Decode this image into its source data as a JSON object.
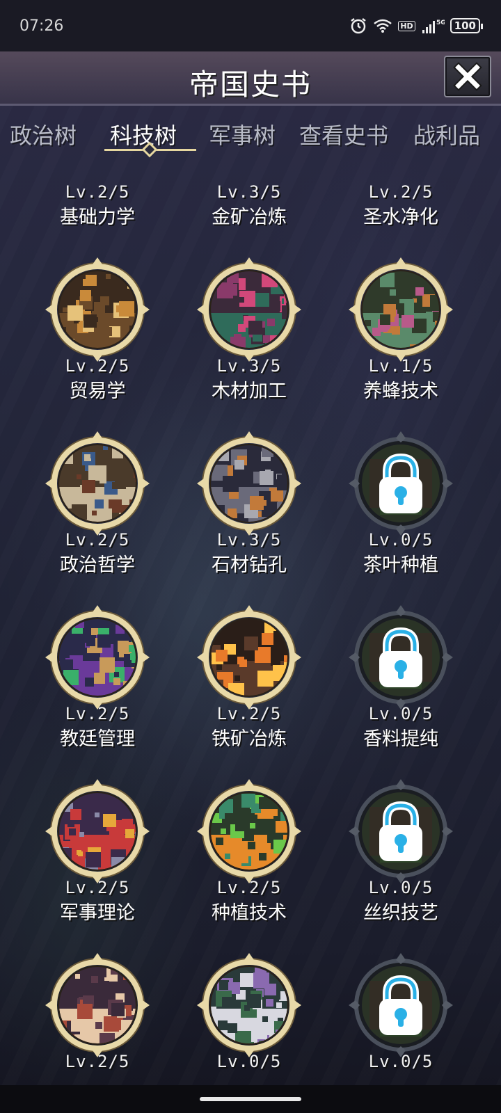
{
  "status_bar": {
    "time": "07:26",
    "icons": [
      "alarm-icon",
      "wifi-icon",
      "hd-icon",
      "signal-5g-icon",
      "battery-icon"
    ],
    "hd_label": "HD",
    "network_label": "5G",
    "battery_level": "100"
  },
  "header": {
    "title": "帝国史书",
    "close_icon": "close-icon"
  },
  "tabs": [
    {
      "label": "政治树",
      "active": false
    },
    {
      "label": "科技树",
      "active": true
    },
    {
      "label": "军事树",
      "active": false
    },
    {
      "label": "查看史书",
      "active": false
    },
    {
      "label": "战利品",
      "active": false
    }
  ],
  "techs": [
    {
      "level": "Lv.2/5",
      "name": "基础力学",
      "locked": false
    },
    {
      "level": "Lv.3/5",
      "name": "金矿冶炼",
      "locked": false
    },
    {
      "level": "Lv.2/5",
      "name": "圣水净化",
      "locked": false
    },
    {
      "level": "Lv.2/5",
      "name": "贸易学",
      "locked": false,
      "palette": [
        "#3a2a1e",
        "#c98a3a",
        "#6b4a2a",
        "#e6c27a"
      ]
    },
    {
      "level": "Lv.3/5",
      "name": "木材加工",
      "locked": false,
      "palette": [
        "#3b2a3a",
        "#d2487a",
        "#2f6b5a",
        "#8a3a6a"
      ]
    },
    {
      "level": "Lv.1/5",
      "name": "养蜂技术",
      "locked": false,
      "palette": [
        "#2f3a2a",
        "#b85a8a",
        "#5a8a6a",
        "#c27a3a"
      ]
    },
    {
      "level": "Lv.2/5",
      "name": "政治哲学",
      "locked": false,
      "palette": [
        "#4a3a2a",
        "#6a3a28",
        "#c8b89a",
        "#3a5a8a"
      ]
    },
    {
      "level": "Lv.3/5",
      "name": "石材钻孔",
      "locked": false,
      "palette": [
        "#2a2a3a",
        "#a8a8b0",
        "#6a6a7a",
        "#c27a3a"
      ]
    },
    {
      "level": "Lv.0/5",
      "name": "茶叶种植",
      "locked": true
    },
    {
      "level": "Lv.2/5",
      "name": "教廷管理",
      "locked": false,
      "palette": [
        "#2a2a4a",
        "#3ab06a",
        "#6a3a9a",
        "#c89a5a"
      ]
    },
    {
      "level": "Lv.2/5",
      "name": "铁矿冶炼",
      "locked": false,
      "palette": [
        "#2a1e18",
        "#e87a2a",
        "#5a3a2a",
        "#ffc24a"
      ]
    },
    {
      "level": "Lv.0/5",
      "name": "香料提纯",
      "locked": true
    },
    {
      "level": "Lv.2/5",
      "name": "军事理论",
      "locked": false,
      "palette": [
        "#3a2a4a",
        "#e6a83a",
        "#c83a3a",
        "#8a8aa8"
      ]
    },
    {
      "level": "Lv.2/5",
      "name": "种植技术",
      "locked": false,
      "palette": [
        "#2a3a2a",
        "#6ac84a",
        "#e68a2a",
        "#3a8a6a"
      ]
    },
    {
      "level": "Lv.0/5",
      "name": "丝织技艺",
      "locked": true
    },
    {
      "level": "Lv.2/5",
      "name": "",
      "locked": false,
      "palette": [
        "#3a2a3a",
        "#a84a3a",
        "#e6c8a8",
        "#5a3a4a"
      ]
    },
    {
      "level": "Lv.0/5",
      "name": "",
      "locked": false,
      "palette": [
        "#2a3a3a",
        "#8a6ab0",
        "#d8d8e0",
        "#3a6a4a"
      ]
    },
    {
      "level": "Lv.0/5",
      "name": "",
      "locked": true
    }
  ],
  "colors": {
    "ring_gold": "#e8d9a8",
    "ring_dark": "#3a3f4a",
    "lock_blue": "#2ab0e6",
    "tab_underline": "#e6d7a0"
  }
}
